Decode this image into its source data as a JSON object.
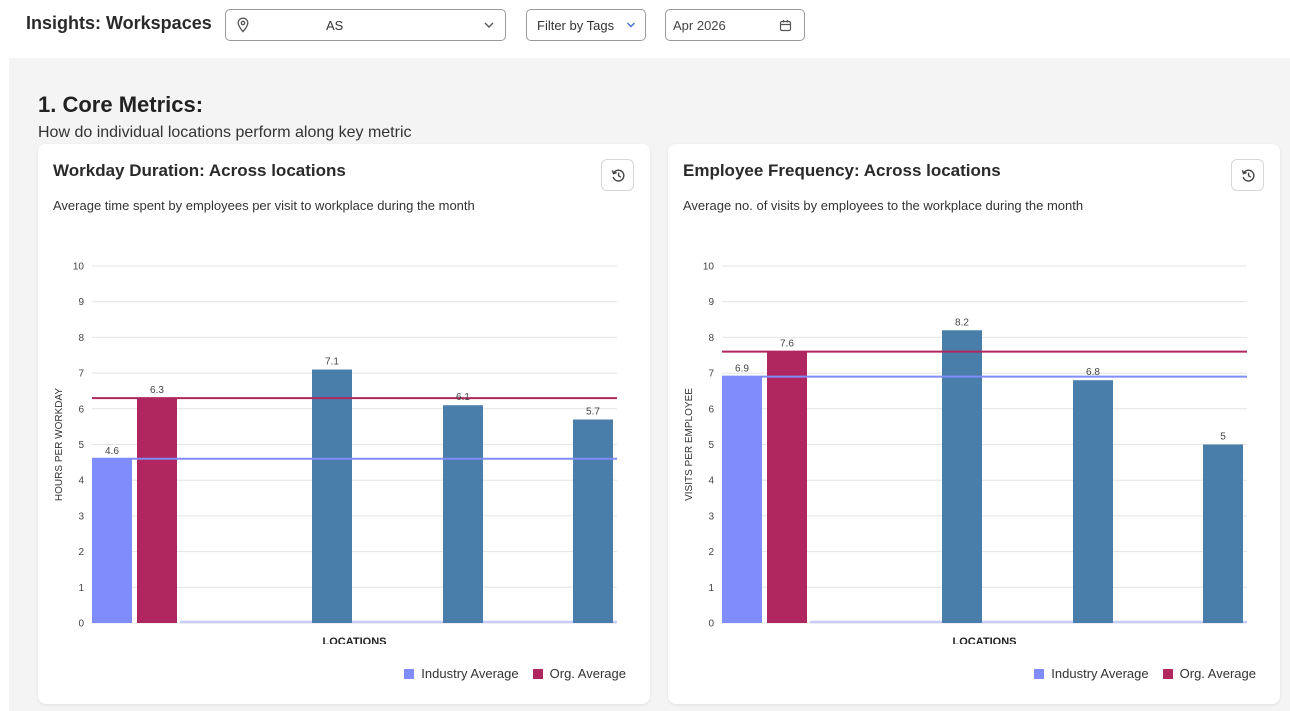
{
  "header": {
    "title": "Insights: Workspaces",
    "location_value": "AS",
    "filter_label": "Filter by Tags",
    "date_value": "Apr 2026"
  },
  "section": {
    "title": "1. Core Metrics:",
    "subtitle": "How do individual locations perform along key metric"
  },
  "colors": {
    "industry": "#7f8cfa",
    "org": "#b0265e",
    "location_bar": "#4a7eaa",
    "grid": "#e4e4e4"
  },
  "cards": [
    {
      "title": "Workday Duration: Across locations",
      "description": "Average time spent by employees per visit to workplace during the month",
      "chart_data": {
        "type": "bar",
        "categories": [
          "Industry Average",
          "Org. Average",
          "",
          "",
          ""
        ],
        "values": [
          4.6,
          6.3,
          7.1,
          6.1,
          5.7
        ],
        "data_labels": [
          "4.6",
          "6.3",
          "7.1",
          "6.1",
          "5.7"
        ],
        "ref_lines": {
          "industry": 4.6,
          "org": 6.3
        },
        "ylim": [
          0,
          10
        ],
        "yticks": [
          "0",
          "1",
          "2",
          "3",
          "4",
          "5",
          "6",
          "7",
          "8",
          "9",
          "10"
        ],
        "xlabel": "LOCATIONS",
        "ylabel": "HOURS PER WORKDAY",
        "legend": [
          "Industry Average",
          "Org. Average"
        ],
        "legend_position": "bottom-right",
        "grid": true
      }
    },
    {
      "title": "Employee Frequency: Across locations",
      "description": "Average no. of visits by employees to the workplace during the month",
      "chart_data": {
        "type": "bar",
        "categories": [
          "Industry Average",
          "Org. Average",
          "",
          "",
          ""
        ],
        "values": [
          6.9,
          7.6,
          8.2,
          6.8,
          5
        ],
        "data_labels": [
          "6.9",
          "7.6",
          "8.2",
          "6.8",
          "5"
        ],
        "ref_lines": {
          "industry": 6.9,
          "org": 7.6
        },
        "ylim": [
          0,
          10
        ],
        "yticks": [
          "0",
          "1",
          "2",
          "3",
          "4",
          "5",
          "6",
          "7",
          "8",
          "9",
          "10"
        ],
        "xlabel": "LOCATIONS",
        "ylabel": "VISITS PER EMPLOYEE",
        "legend": [
          "Industry Average",
          "Org. Average"
        ],
        "legend_position": "bottom-right",
        "grid": true
      }
    }
  ]
}
